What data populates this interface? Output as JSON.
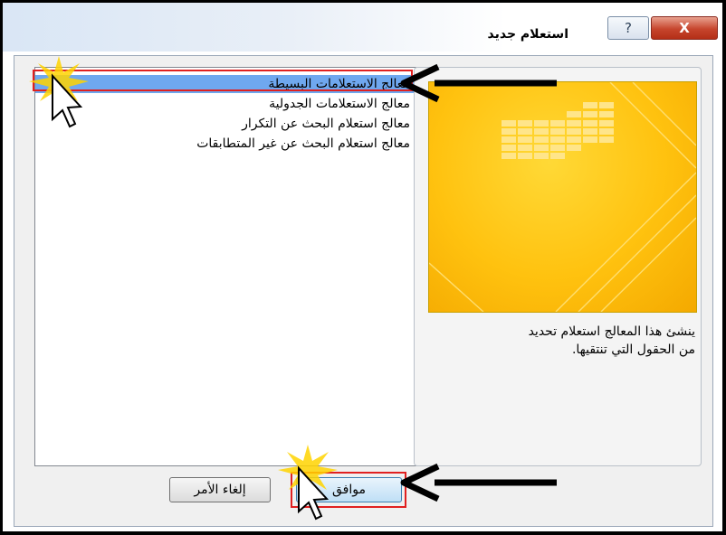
{
  "dialog": {
    "title": "استعلام جديد",
    "help_label": "?",
    "close_label": "X"
  },
  "wizard_list": {
    "items": [
      {
        "label": "معالج الاستعلامات البسيطة",
        "selected": true
      },
      {
        "label": "معالج الاستعلامات الجدولية",
        "selected": false
      },
      {
        "label": "معالج استعلام البحث عن التكرار",
        "selected": false
      },
      {
        "label": "معالج استعلام البحث عن غير المتطابقات",
        "selected": false
      }
    ]
  },
  "description": {
    "line1": "ينشئ هذا المعالج استعلام تحديد",
    "line2": "من الحقول التي تنتقيها."
  },
  "buttons": {
    "ok_label": "موافق",
    "cancel_label": "إلغاء الأمر"
  },
  "colors": {
    "selection": "#6fa8ef",
    "highlight_outline": "#e02020",
    "preview_background": "#ffc20f"
  },
  "icons": [
    "help-icon",
    "close-icon",
    "pointer-arrow-icon",
    "cursor-icon"
  ]
}
